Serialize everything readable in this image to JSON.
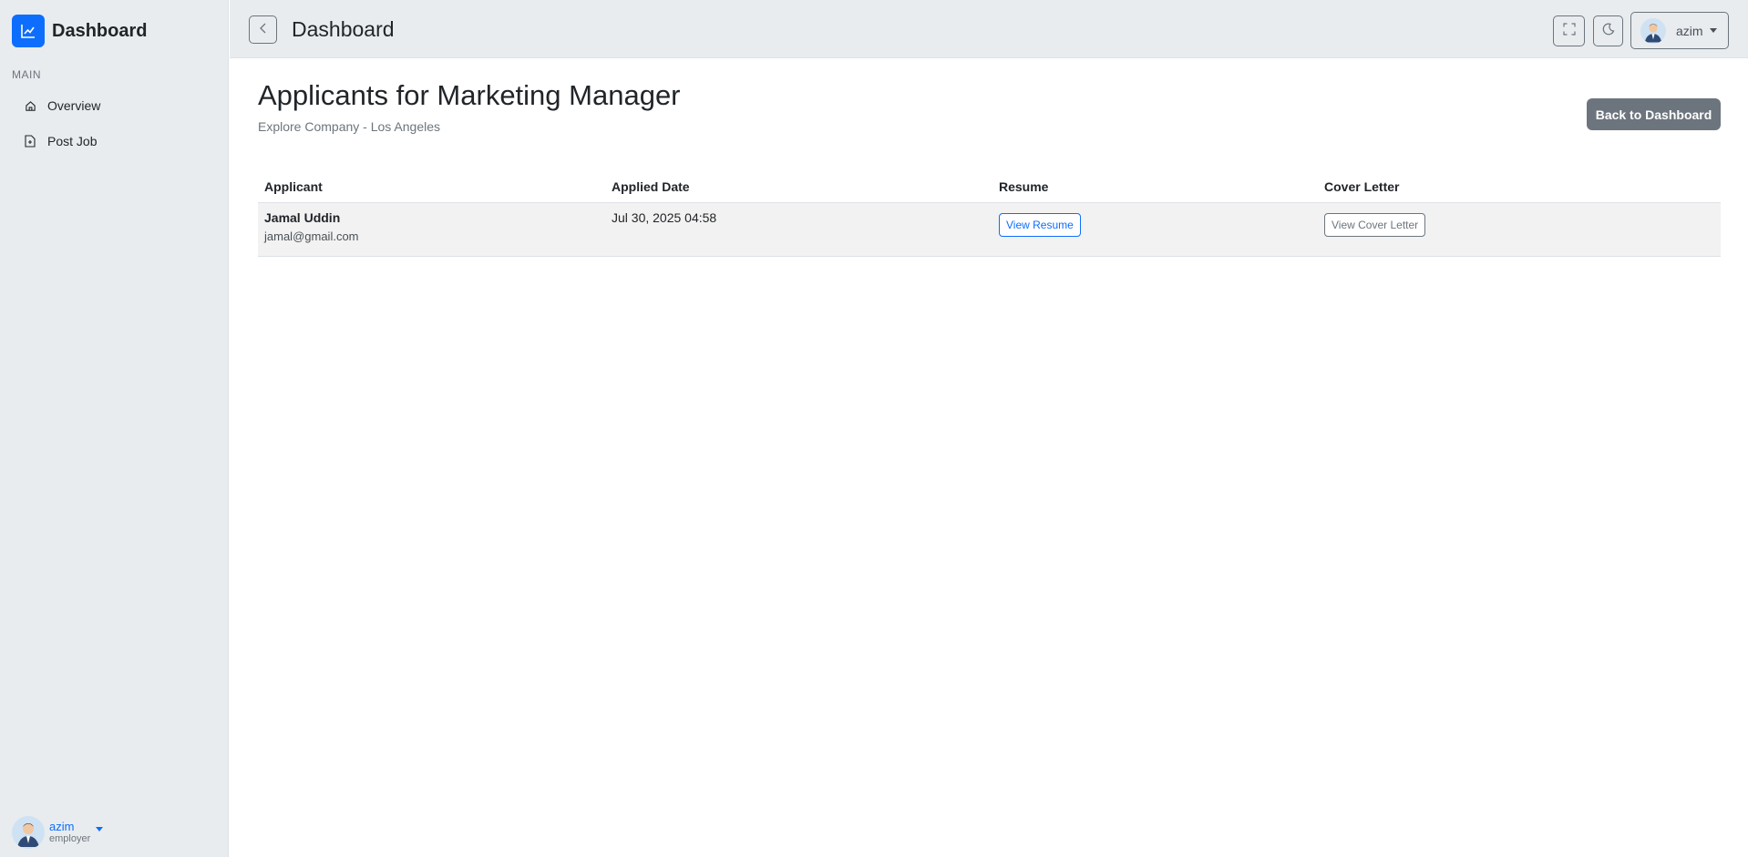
{
  "sidebar": {
    "brand": "Dashboard",
    "section_label": "MAIN",
    "items": [
      {
        "label": "Overview",
        "icon": "home-icon"
      },
      {
        "label": "Post Job",
        "icon": "file-plus-icon"
      }
    ],
    "user": {
      "name": "azim",
      "role": "employer"
    }
  },
  "topbar": {
    "title": "Dashboard",
    "user_name": "azim"
  },
  "page": {
    "title": "Applicants for Marketing Manager",
    "subtitle": "Explore Company - Los Angeles",
    "back_button": "Back to Dashboard"
  },
  "table": {
    "headers": [
      "Applicant",
      "Applied Date",
      "Resume",
      "Cover Letter"
    ],
    "rows": [
      {
        "name": "Jamal Uddin",
        "email": "jamal@gmail.com",
        "applied": "Jul 30, 2025 04:58",
        "resume_label": "View Resume",
        "cover_label": "View Cover Letter"
      }
    ]
  },
  "colors": {
    "accent": "#0d6efd",
    "secondary": "#6c757d",
    "panel_bg": "#e9ecef"
  }
}
